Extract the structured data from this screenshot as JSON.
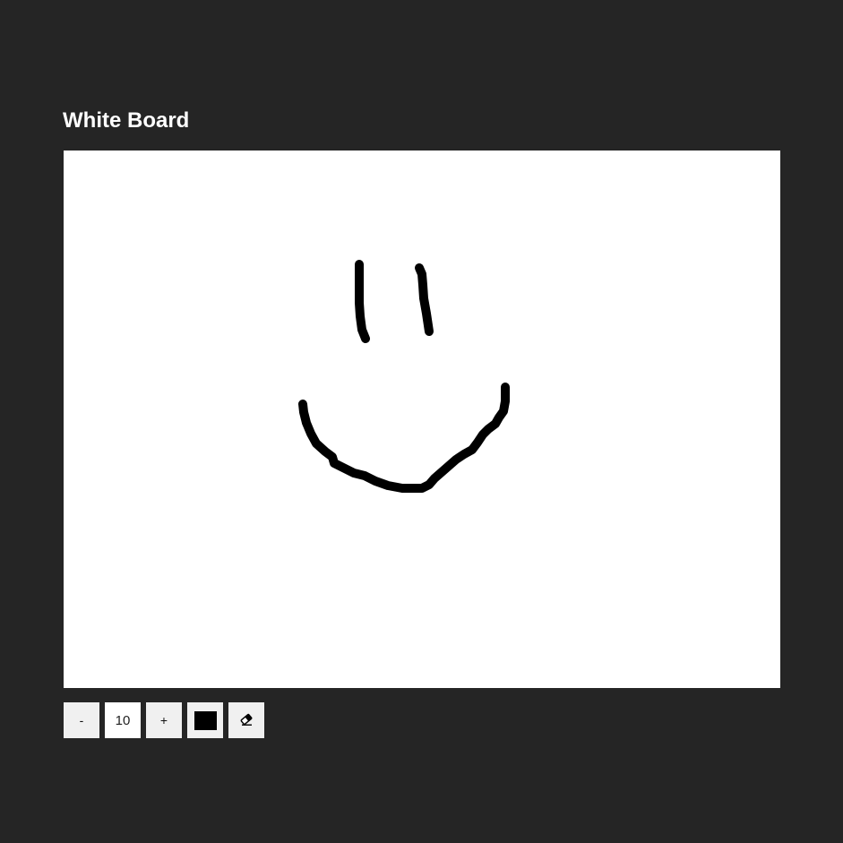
{
  "page": {
    "title": "White Board"
  },
  "board": {
    "background": "#ffffff",
    "stroke_color": "#000000"
  },
  "toolbar": {
    "decrease_label": "-",
    "brush_size": "10",
    "increase_label": "+",
    "color_value": "#000000",
    "eraser_icon": "eraser-icon"
  }
}
